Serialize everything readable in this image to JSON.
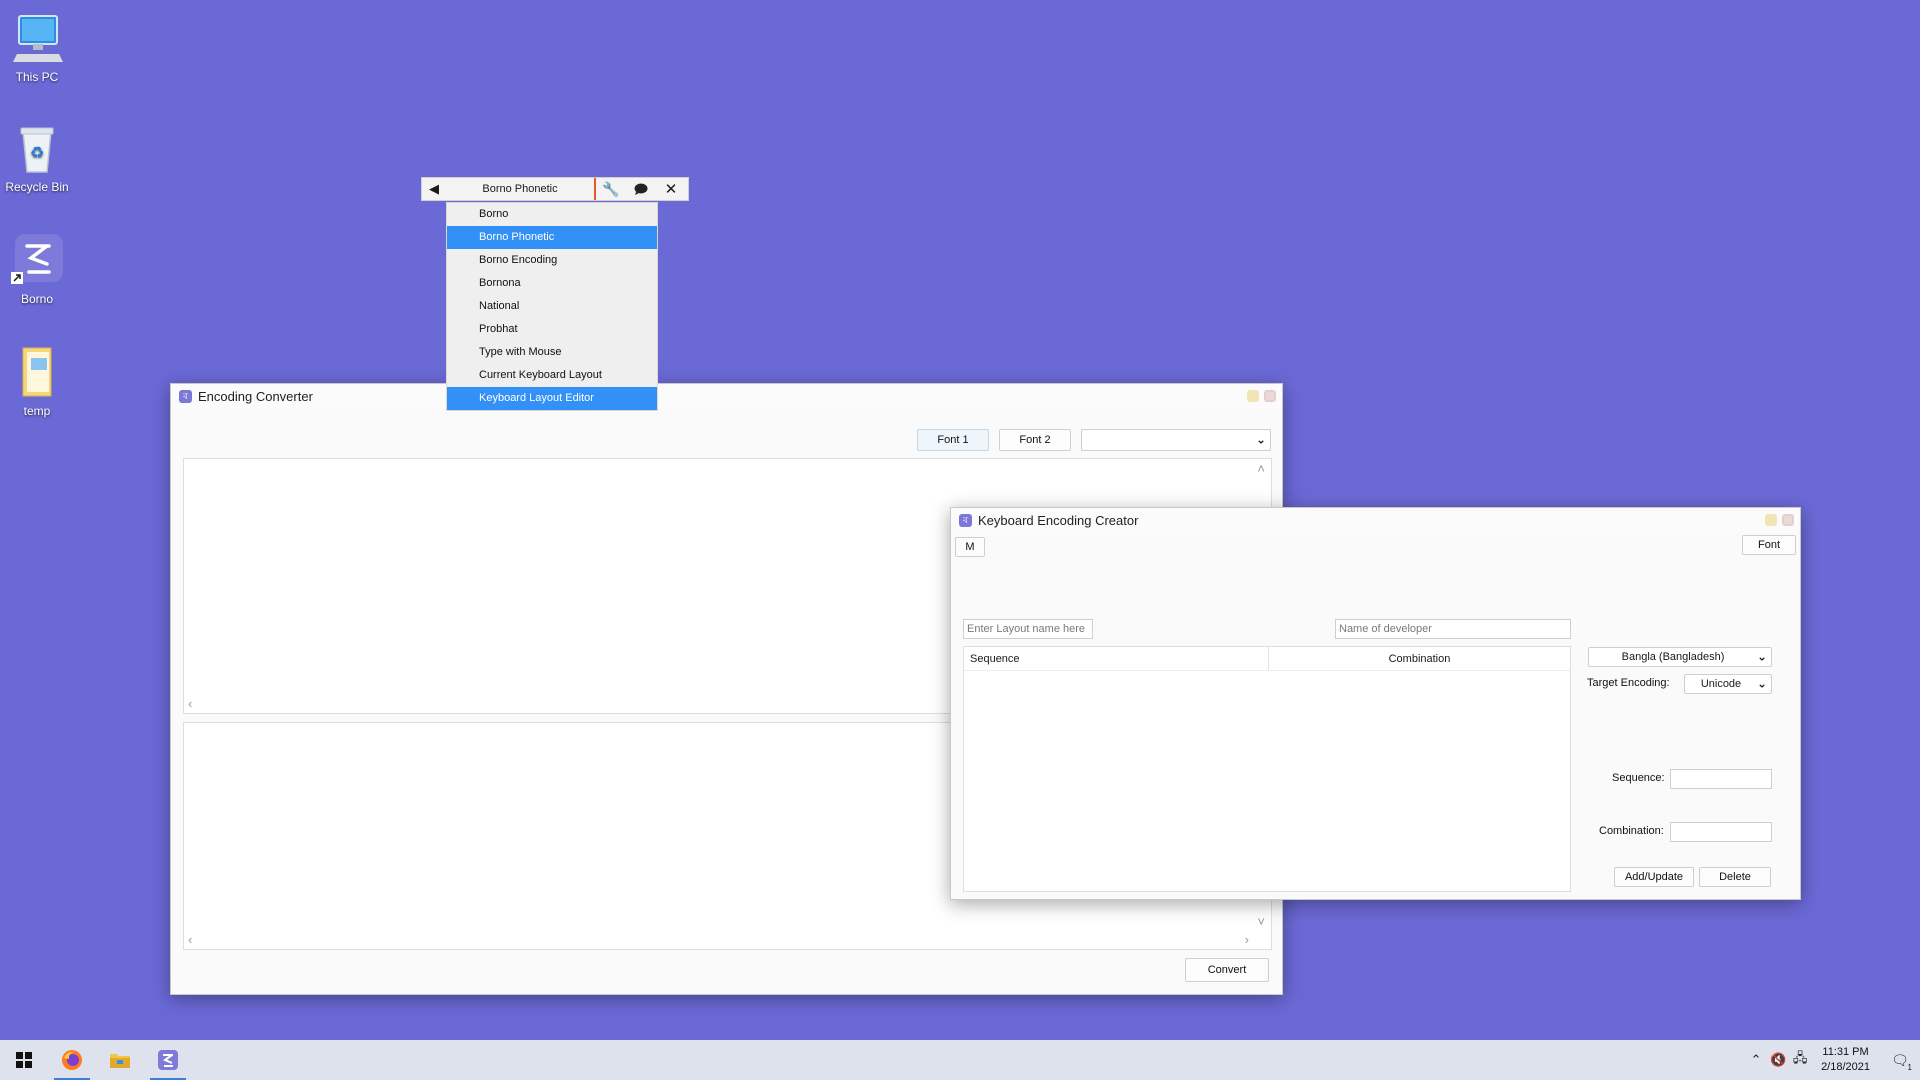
{
  "desktop": {
    "icons": [
      {
        "label": "This PC",
        "icon": "monitor-icon"
      },
      {
        "label": "Recycle Bin",
        "icon": "recycle-bin-icon"
      },
      {
        "label": "Borno",
        "icon": "borno-app-icon"
      },
      {
        "label": "temp",
        "icon": "folder-icon"
      }
    ],
    "background": "#6b69d6"
  },
  "borno_toolbar": {
    "current_layout": "Borno Phonetic",
    "accent": "#e05a2b"
  },
  "layout_menu": {
    "items": [
      {
        "label": "Borno",
        "highlighted": false
      },
      {
        "label": "Borno Phonetic",
        "highlighted": true
      },
      {
        "label": "Borno Encoding",
        "highlighted": false
      },
      {
        "label": "Bornona",
        "highlighted": false
      },
      {
        "label": "National",
        "highlighted": false
      },
      {
        "label": "Probhat",
        "highlighted": false
      },
      {
        "label": "Type with Mouse",
        "highlighted": false
      },
      {
        "label": "Current Keyboard Layout",
        "highlighted": false
      },
      {
        "label": "Keyboard Layout Editor",
        "highlighted": true
      }
    ],
    "highlight_color": "#3390f6"
  },
  "encoding_converter": {
    "title": "Encoding Converter",
    "font1_label": "Font 1",
    "font2_label": "Font 2",
    "encoding_select_value": "",
    "convert_label": "Convert"
  },
  "keyboard_creator": {
    "title": "Keyboard Encoding Creator",
    "m_label": "M",
    "font_label": "Font",
    "layout_name_placeholder": "Enter Layout name here",
    "developer_placeholder": "Name of developer",
    "table_headers": [
      "Sequence",
      "Combination"
    ],
    "language_select": "Bangla (Bangladesh)",
    "target_encoding_label": "Target Encoding:",
    "target_encoding_value": "Unicode",
    "sequence_label": "Sequence:",
    "combination_label": "Combination:",
    "add_update_label": "Add/Update",
    "delete_label": "Delete"
  },
  "taskbar": {
    "time": "11:31 PM",
    "date": "2/18/2021",
    "notification_count": "1"
  }
}
